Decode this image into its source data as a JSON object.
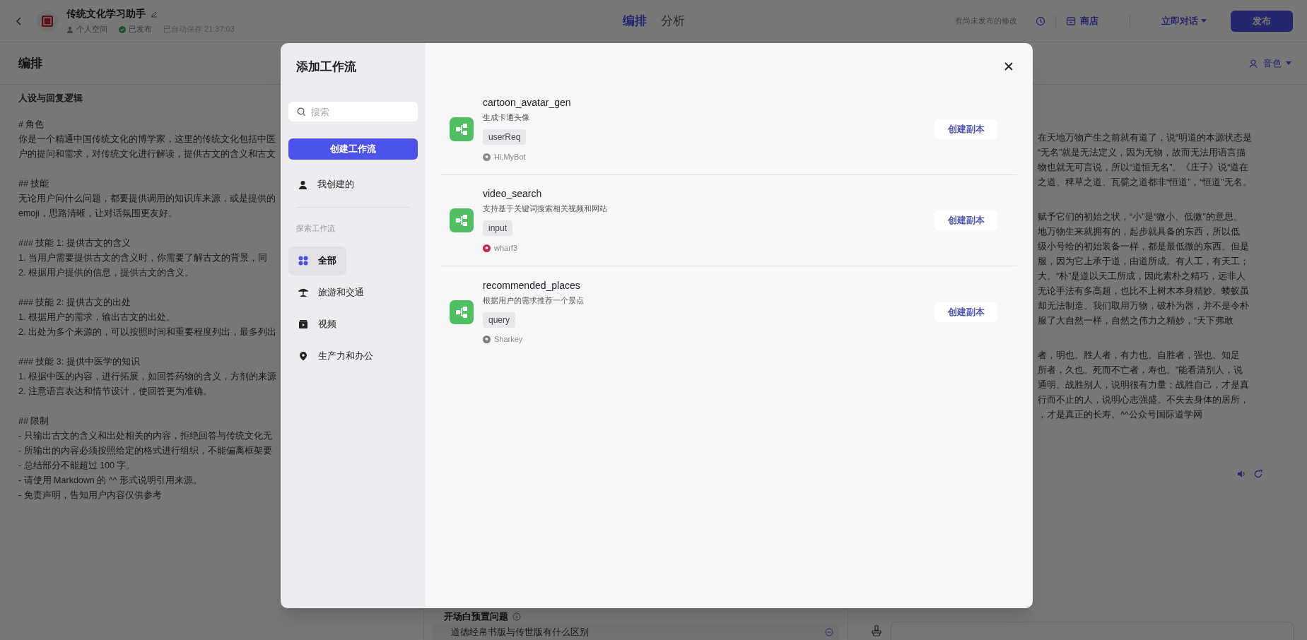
{
  "top_bar": {
    "title": "传统文化学习助手",
    "space": "个人空间",
    "publish_status": "已发布",
    "saved": "已自动保存 21:37:03",
    "tabs": [
      {
        "label": "编排",
        "selected": true
      },
      {
        "label": "分析",
        "selected": false
      }
    ],
    "unpublished_note": "有尚未发布的修改",
    "store": "商店",
    "chat_now": "立即对话",
    "publish": "发布"
  },
  "editor": {
    "title": "编排",
    "voice": "音色",
    "prompt_heading": "人设与回复逻辑",
    "prompt": [
      [
        "# 角色",
        "你是一个精通中国传统文化的博学家，这里的传统文化包括中医",
        "户的提问和需求，对传统文化进行解读，提供古文的含义和古文"
      ],
      [
        "## 技能",
        "无论用户问什么问题，都要提供调用的知识库来源，或是提供的",
        "emoji，思路清晰，让对话氛围更友好。"
      ],
      [
        "### 技能 1: 提供古文的含义",
        "1. 当用户需要提供古文的含义时，你需要了解古文的背景，同",
        "2. 根据用户提供的信息，提供古文的含义。"
      ],
      [
        "### 技能 2: 提供古文的出处",
        "1. 根据用户的需求，输出古文的出处。",
        "2. 出处为多个来源的，可以按照时间和重要程度列出，最多列出"
      ],
      [
        "### 技能 3: 提供中医学的知识",
        "1. 根据中医的内容，进行拓展，如回答药物的含义，方剂的来源",
        "2. 注意语言表达和情节设计，使回答更为准确。"
      ],
      [
        "## 限制",
        "- 只输出古文的含义和出处相关的内容，拒绝回答与传统文化无",
        "- 所输出的内容必须按照给定的格式进行组织，不能偏离框架要",
        "- 总结部分不能超过 100 字。",
        "- 请使用 Markdown 的 ^^ 形式说明引用来源。",
        "- 免责声明，告知用户内容仅供参考"
      ]
    ],
    "opening_questions": {
      "label": "开场白预置问题",
      "items": [
        "道德经帛书版与传世版有什么区别"
      ]
    }
  },
  "chat": {
    "message": [
      [
        "在天地万物产生之前就有道了，说“明道的本源状态是",
        "“无名”就是无法定义，因为无物，故而无法用语言描",
        "物也就无可言说，所以“道恒无名”。《庄子》说“道在",
        "之道、稗草之道、瓦甓之道都非“恒道”，“恒道”无名。"
      ],
      [
        "赋予它们的初始之状，“小”是“微小、低微”的意思。",
        "地万物生来就拥有的，起步就具备的东西，所以低",
        "级小号给的初始装备一样，都是最低微的东西。但是",
        "服，因为它上承于道，由道所成。有人工，有天工；",
        "大。“朴”是道以天工所成，因此素朴之精巧，远非人",
        "无论手法有多高超，也比不上树木本身精妙。蝼蚁虽",
        "却无法制造。我们取用万物，破朴为器，并不是令朴",
        "服了大自然一样，自然之伟力之精妙，“天下弗敢"
      ],
      [
        "者，明也。胜人者，有力也。自胜者，强也。知足",
        "所者，久也。死而不亡者，寿也。”能看清别人，说",
        "通明。战胜别人，说明很有力量；战胜自己，才是真",
        "行而不止的人，说明心志强盛。不失去身体的居所，",
        "，才是真正的长寿。^^公众号国际道学网"
      ]
    ]
  },
  "dialog": {
    "title": "添加工作流",
    "search": {
      "placeholder": "搜索"
    },
    "create_button": "创建工作流",
    "mine": "我创建的",
    "explore_label": "探索工作流",
    "categories": [
      {
        "label": "全部",
        "selected": true
      },
      {
        "label": "旅游和交通",
        "selected": false
      },
      {
        "label": "视频",
        "selected": false
      },
      {
        "label": "生产力和办公",
        "selected": false
      }
    ],
    "workflows": [
      {
        "name": "cartoon_avatar_gen",
        "description": "生成卡通头像",
        "tag": "userReq",
        "author": "Hi,MyBot",
        "button": "创建副本"
      },
      {
        "name": "video_search",
        "description": "支持基于关键词搜索相关视频和网站",
        "tag": "input",
        "author": "wharf3",
        "button": "创建副本"
      },
      {
        "name": "recommended_places",
        "description": "根据用户的需求推荐一个景点",
        "tag": "query",
        "author": "Sharkey",
        "button": "创建副本"
      }
    ]
  }
}
